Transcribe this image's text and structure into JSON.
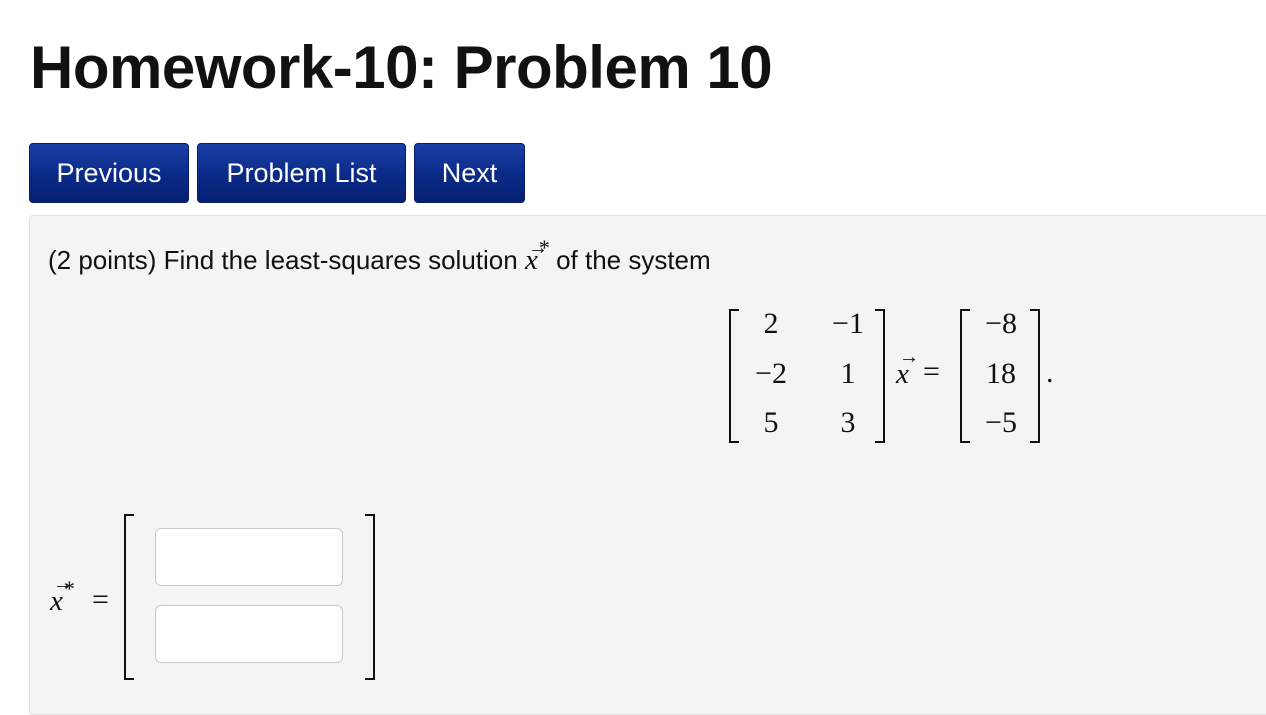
{
  "header": {
    "title": "Homework-10: Problem 10"
  },
  "nav": {
    "previous": "Previous",
    "problem_list": "Problem List",
    "next": "Next"
  },
  "problem": {
    "points": "(2 points)",
    "text_before": "Find the least-squares solution",
    "vector_symbol": "x",
    "vector_star": "*",
    "text_after": "of the system",
    "matrix": [
      [
        "2",
        "−1"
      ],
      [
        "−2",
        "1"
      ],
      [
        "5",
        "3"
      ]
    ],
    "rhs": [
      "−8",
      "18",
      "−5"
    ],
    "equals": "=",
    "period": "."
  },
  "answer": {
    "symbol": "x",
    "star": "*",
    "equals": "=",
    "inputs": [
      {
        "value": "",
        "placeholder": ""
      },
      {
        "value": "",
        "placeholder": ""
      }
    ]
  }
}
